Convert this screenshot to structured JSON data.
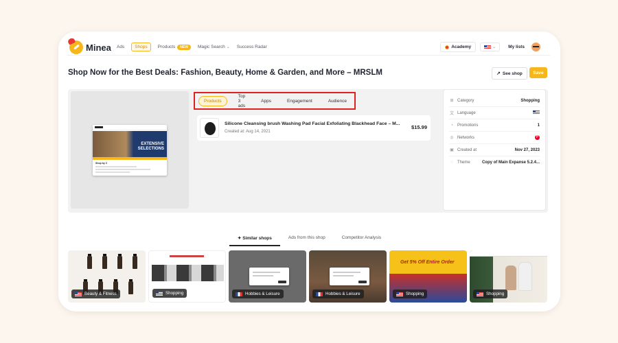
{
  "brand": {
    "name": "Minea"
  },
  "nav": {
    "ads": "Ads",
    "shops": "Shops",
    "products": "Products",
    "products_badge": "NEW",
    "magic_search": "Magic Search",
    "success_radar": "Success Radar"
  },
  "header_right": {
    "academy": "Academy",
    "my_lists": "My lists"
  },
  "page": {
    "title": "Shop Now for the Best Deals: Fashion, Beauty, Home & Garden, and More – MRSLM",
    "see_shop": "See shop",
    "save": "Save"
  },
  "preview": {
    "hero_line1": "EXTENSIVE",
    "hero_line2": "SELECTIONS",
    "sub_heading": "Shop by C"
  },
  "shop_tabs": [
    "Products",
    "Top 3 ads",
    "Apps",
    "Engagement",
    "Audience"
  ],
  "product": {
    "name": "Silicone Cleansing brush Washing Pad Facial Exfoliating Blackhead Face – M...",
    "created": "Created at: Aug 14, 2021",
    "price": "$15.99"
  },
  "info": {
    "category_label": "Category",
    "category_value": "Shopping",
    "language_label": "Language",
    "promotions_label": "Promotions",
    "promotions_value": "1",
    "networks_label": "Networks",
    "network_icon": "pinterest-icon",
    "created_label": "Created at",
    "created_value": "Nov 27, 2023",
    "theme_label": "Theme",
    "theme_value": "Copy of Main Expanse 5.2.4..."
  },
  "lower_tabs": {
    "similar": "Similar shops",
    "ads": "Ads from this shop",
    "competitor": "Competitor Analysis"
  },
  "similar_shops": [
    {
      "category": "Beauty & Fitness",
      "flag": "us"
    },
    {
      "category": "Shopping",
      "flag": "us"
    },
    {
      "category": "Hobbies & Leisure",
      "flag": "fr"
    },
    {
      "category": "Hobbies & Leisure",
      "flag": "fr"
    },
    {
      "category": "Shopping",
      "flag": "us"
    },
    {
      "category": "Shopping",
      "flag": "us"
    }
  ],
  "card4_promo": {
    "line1": "Get 5% Off Entire Order"
  },
  "colors": {
    "accent": "#f6b71d",
    "highlight_box": "#e0201c",
    "background": "#fdf6ee"
  }
}
